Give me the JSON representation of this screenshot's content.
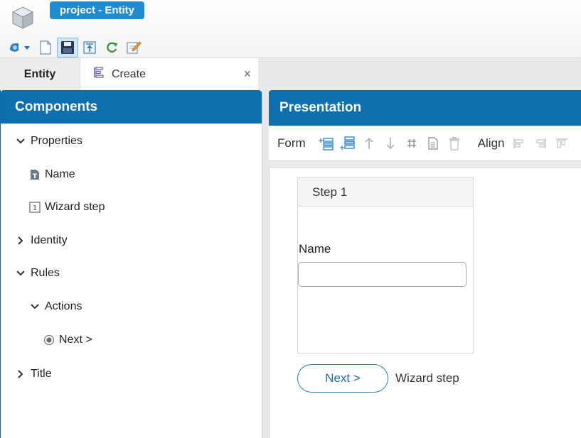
{
  "window": {
    "project_tab": "project - Entity"
  },
  "toolbar": {
    "buttons": [
      "dropdown-icon",
      "new-document-icon",
      "save-icon",
      "export-icon",
      "refresh-icon",
      "edit-icon"
    ]
  },
  "tabs": {
    "entity_label": "Entity",
    "create_label": "Create",
    "close_glyph": "×"
  },
  "components": {
    "title": "Components",
    "items": [
      {
        "label": "Properties",
        "expanded": true,
        "level": 0
      },
      {
        "label": "Name",
        "icon": "text-field-icon",
        "level": 1
      },
      {
        "label": "Wizard step",
        "icon": "step-number-icon",
        "level": 1
      },
      {
        "label": "Identity",
        "expanded": false,
        "level": 0
      },
      {
        "label": "Rules",
        "expanded": true,
        "level": 0
      },
      {
        "label": "Actions",
        "expanded": true,
        "level": 1
      },
      {
        "label": "Next >",
        "icon": "radio-icon",
        "level": 2
      },
      {
        "label": "Title",
        "expanded": false,
        "level": 0
      }
    ]
  },
  "presentation": {
    "title": "Presentation",
    "form_label": "Form",
    "align_label": "Align",
    "step_title": "Step 1",
    "field_label": "Name",
    "field_value": "",
    "next_button": "Next >",
    "wizard_label": "Wizard step"
  },
  "colors": {
    "header_blue": "#0d6fae",
    "project_tab_blue": "#1f8bd1",
    "button_blue": "#1f6ea6"
  }
}
